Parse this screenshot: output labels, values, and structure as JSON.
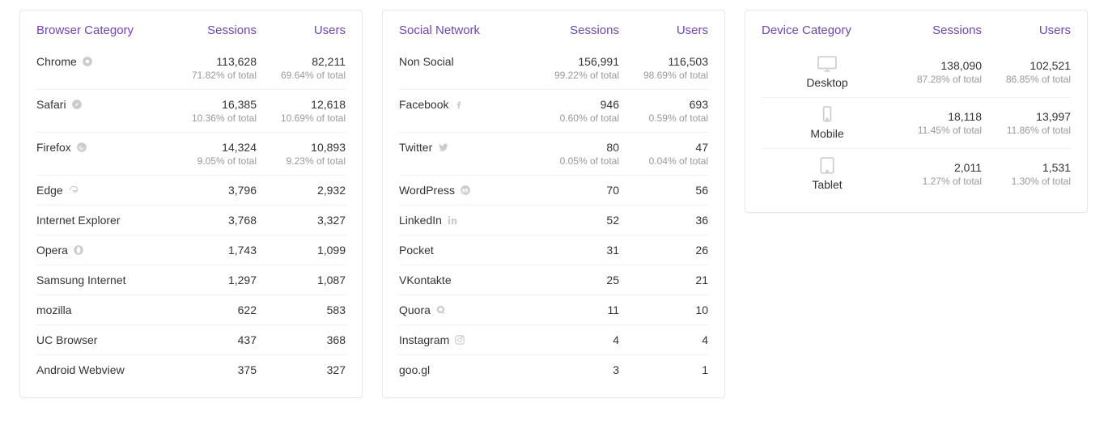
{
  "of_total_label": "of total",
  "browser": {
    "title": "Browser Category",
    "col_sessions": "Sessions",
    "col_users": "Users",
    "rows": [
      {
        "name": "Chrome",
        "icon": "chrome-icon",
        "sessions": "113,628",
        "sessions_pct": "71.82%",
        "users": "82,211",
        "users_pct": "69.64%"
      },
      {
        "name": "Safari",
        "icon": "safari-icon",
        "sessions": "16,385",
        "sessions_pct": "10.36%",
        "users": "12,618",
        "users_pct": "10.69%"
      },
      {
        "name": "Firefox",
        "icon": "firefox-icon",
        "sessions": "14,324",
        "sessions_pct": "9.05%",
        "users": "10,893",
        "users_pct": "9.23%"
      },
      {
        "name": "Edge",
        "icon": "edge-icon",
        "sessions": "3,796",
        "users": "2,932"
      },
      {
        "name": "Internet Explorer",
        "sessions": "3,768",
        "users": "3,327"
      },
      {
        "name": "Opera",
        "icon": "opera-icon",
        "sessions": "1,743",
        "users": "1,099"
      },
      {
        "name": "Samsung Internet",
        "sessions": "1,297",
        "users": "1,087"
      },
      {
        "name": "mozilla",
        "sessions": "622",
        "users": "583"
      },
      {
        "name": "UC Browser",
        "sessions": "437",
        "users": "368"
      },
      {
        "name": "Android Webview",
        "sessions": "375",
        "users": "327"
      }
    ]
  },
  "social": {
    "title": "Social Network",
    "col_sessions": "Sessions",
    "col_users": "Users",
    "rows": [
      {
        "name": "Non Social",
        "sessions": "156,991",
        "sessions_pct": "99.22%",
        "users": "116,503",
        "users_pct": "98.69%"
      },
      {
        "name": "Facebook",
        "icon": "facebook-icon",
        "sessions": "946",
        "sessions_pct": "0.60%",
        "users": "693",
        "users_pct": "0.59%"
      },
      {
        "name": "Twitter",
        "icon": "twitter-icon",
        "sessions": "80",
        "sessions_pct": "0.05%",
        "users": "47",
        "users_pct": "0.04%"
      },
      {
        "name": "WordPress",
        "icon": "wordpress-icon",
        "sessions": "70",
        "users": "56"
      },
      {
        "name": "LinkedIn",
        "icon": "linkedin-icon",
        "sessions": "52",
        "users": "36"
      },
      {
        "name": "Pocket",
        "sessions": "31",
        "users": "26"
      },
      {
        "name": "VKontakte",
        "sessions": "25",
        "users": "21"
      },
      {
        "name": "Quora",
        "icon": "quora-icon",
        "sessions": "11",
        "users": "10"
      },
      {
        "name": "Instagram",
        "icon": "instagram-icon",
        "sessions": "4",
        "users": "4"
      },
      {
        "name": "goo.gl",
        "sessions": "3",
        "users": "1"
      }
    ]
  },
  "device": {
    "title": "Device Category",
    "col_sessions": "Sessions",
    "col_users": "Users",
    "rows": [
      {
        "name": "Desktop",
        "icon": "desktop-icon",
        "sessions": "138,090",
        "sessions_pct": "87.28%",
        "users": "102,521",
        "users_pct": "86.85%"
      },
      {
        "name": "Mobile",
        "icon": "mobile-icon",
        "sessions": "18,118",
        "sessions_pct": "11.45%",
        "users": "13,997",
        "users_pct": "11.86%"
      },
      {
        "name": "Tablet",
        "icon": "tablet-icon",
        "sessions": "2,011",
        "sessions_pct": "1.27%",
        "users": "1,531",
        "users_pct": "1.30%"
      }
    ]
  }
}
